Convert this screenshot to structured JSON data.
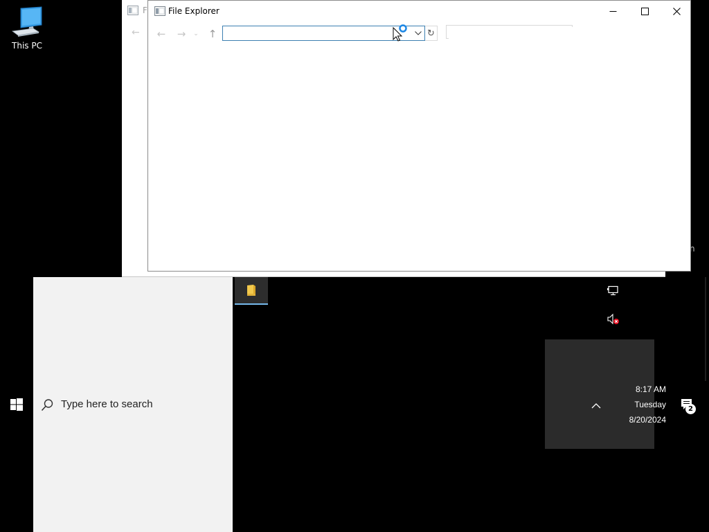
{
  "desktop": {
    "icons": [
      {
        "label": "This PC",
        "icon": "monitor-icon"
      }
    ]
  },
  "background_window": {
    "title_fragment": "F",
    "trailing_fragment": "n"
  },
  "explorer": {
    "title": "File Explorer",
    "address": {
      "value": "",
      "placeholder": ""
    },
    "search": {
      "value": "",
      "placeholder": ""
    },
    "nav": {
      "back": "←",
      "forward": "→",
      "recent": "⌄",
      "up": "↑",
      "refresh": "↻"
    }
  },
  "taskbar": {
    "search_placeholder": "Type here to search",
    "pinned": [
      {
        "name": "File Explorer",
        "icon": "folder-icon",
        "active": true
      }
    ],
    "tray": {
      "time": "8:17 AM",
      "day": "Tuesday",
      "date": "8/20/2024",
      "notifications_count": "2"
    }
  },
  "colors": {
    "accent": "#0078d7",
    "taskbar_active_indicator": "#76b9ed",
    "search_panel": "#f2f2f2",
    "flyout": "#2b2b2b"
  }
}
